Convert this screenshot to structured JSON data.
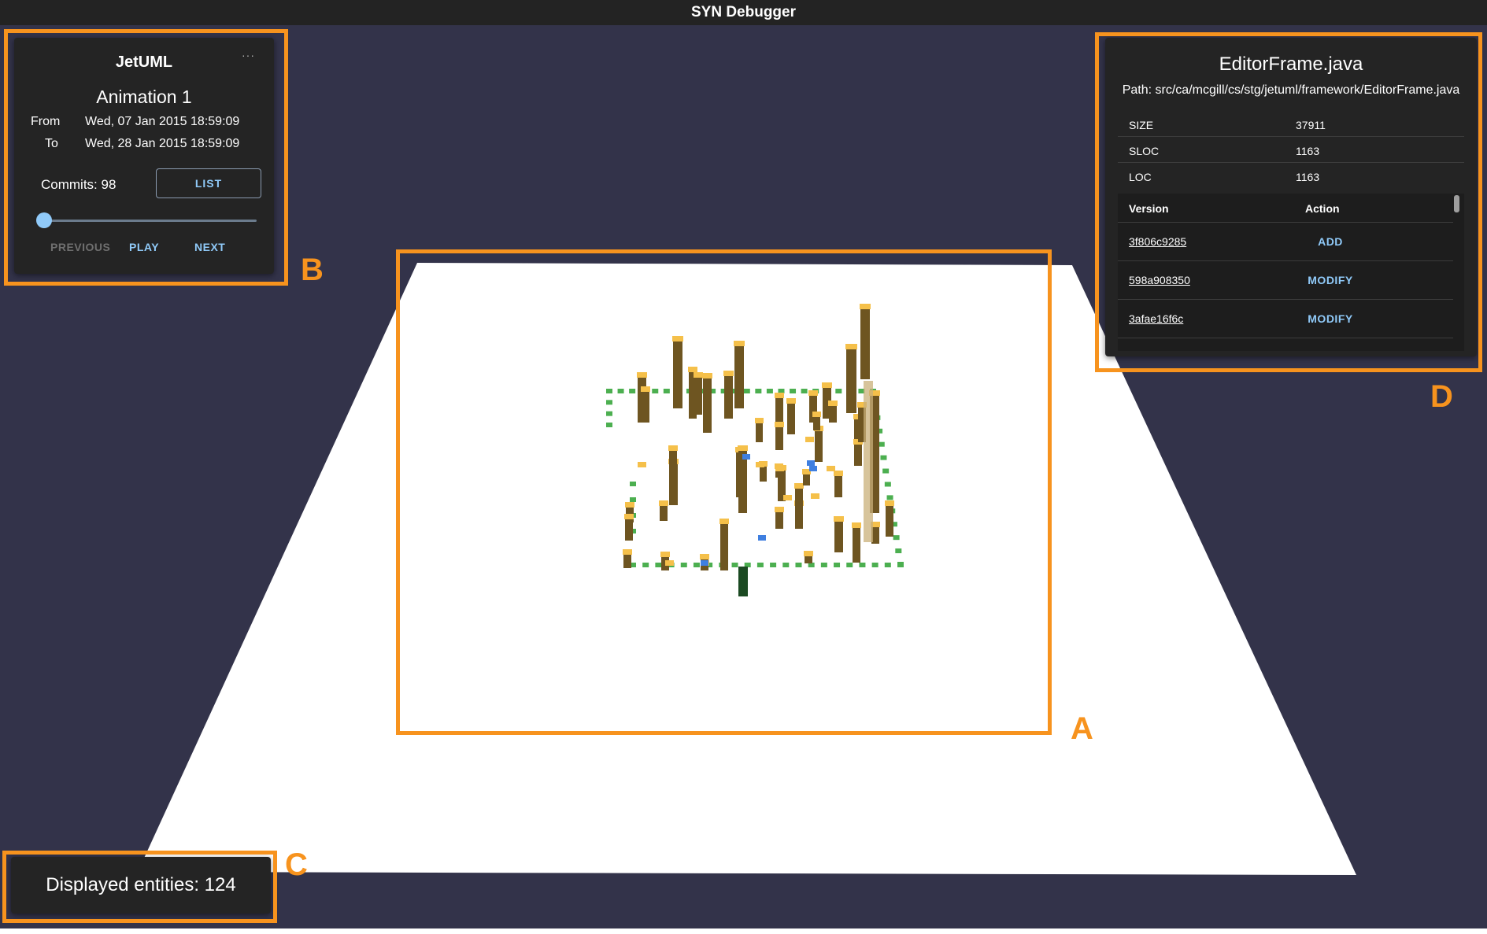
{
  "app": {
    "title": "SYN Debugger"
  },
  "colors": {
    "background": "#33334a",
    "panel": "#242424",
    "accent": "#90caf9",
    "highlight": "#f7931e",
    "plane": "#ffffff",
    "building": "#6e5521",
    "building_top": "#f5c04a",
    "deleted_tile": "#4caf50",
    "added_tile": "#3f7fe0"
  },
  "timeline_panel": {
    "project": "JetUML",
    "menu_icon": "more-horizontal-icon",
    "animation": "Animation 1",
    "from_label": "From",
    "from_value": "Wed, 07 Jan 2015 18:59:09",
    "to_label": "To",
    "to_value": "Wed, 28 Jan 2015 18:59:09",
    "commits_label": "Commits: 98",
    "list_button": "LIST",
    "slider_value": 0,
    "previous_button": "PREVIOUS",
    "play_button": "PLAY",
    "next_button": "NEXT"
  },
  "entities_panel": {
    "text": "Displayed entities: 124"
  },
  "file_panel": {
    "filename": "EditorFrame.java",
    "path": "Path: src/ca/mcgill/cs/stg/jetuml/framework/EditorFrame.java",
    "props": [
      {
        "key": "SIZE",
        "value": "37911"
      },
      {
        "key": "SLOC",
        "value": "1163"
      },
      {
        "key": "LOC",
        "value": "1163"
      }
    ],
    "versions_header": {
      "version": "Version",
      "action": "Action"
    },
    "versions": [
      {
        "sha": "3f806c9285",
        "action": "ADD"
      },
      {
        "sha": "598a908350",
        "action": "MODIFY"
      },
      {
        "sha": "3afae16f6c",
        "action": "MODIFY"
      }
    ]
  },
  "annotations": {
    "a": "A",
    "b": "B",
    "c": "C",
    "d": "D"
  }
}
